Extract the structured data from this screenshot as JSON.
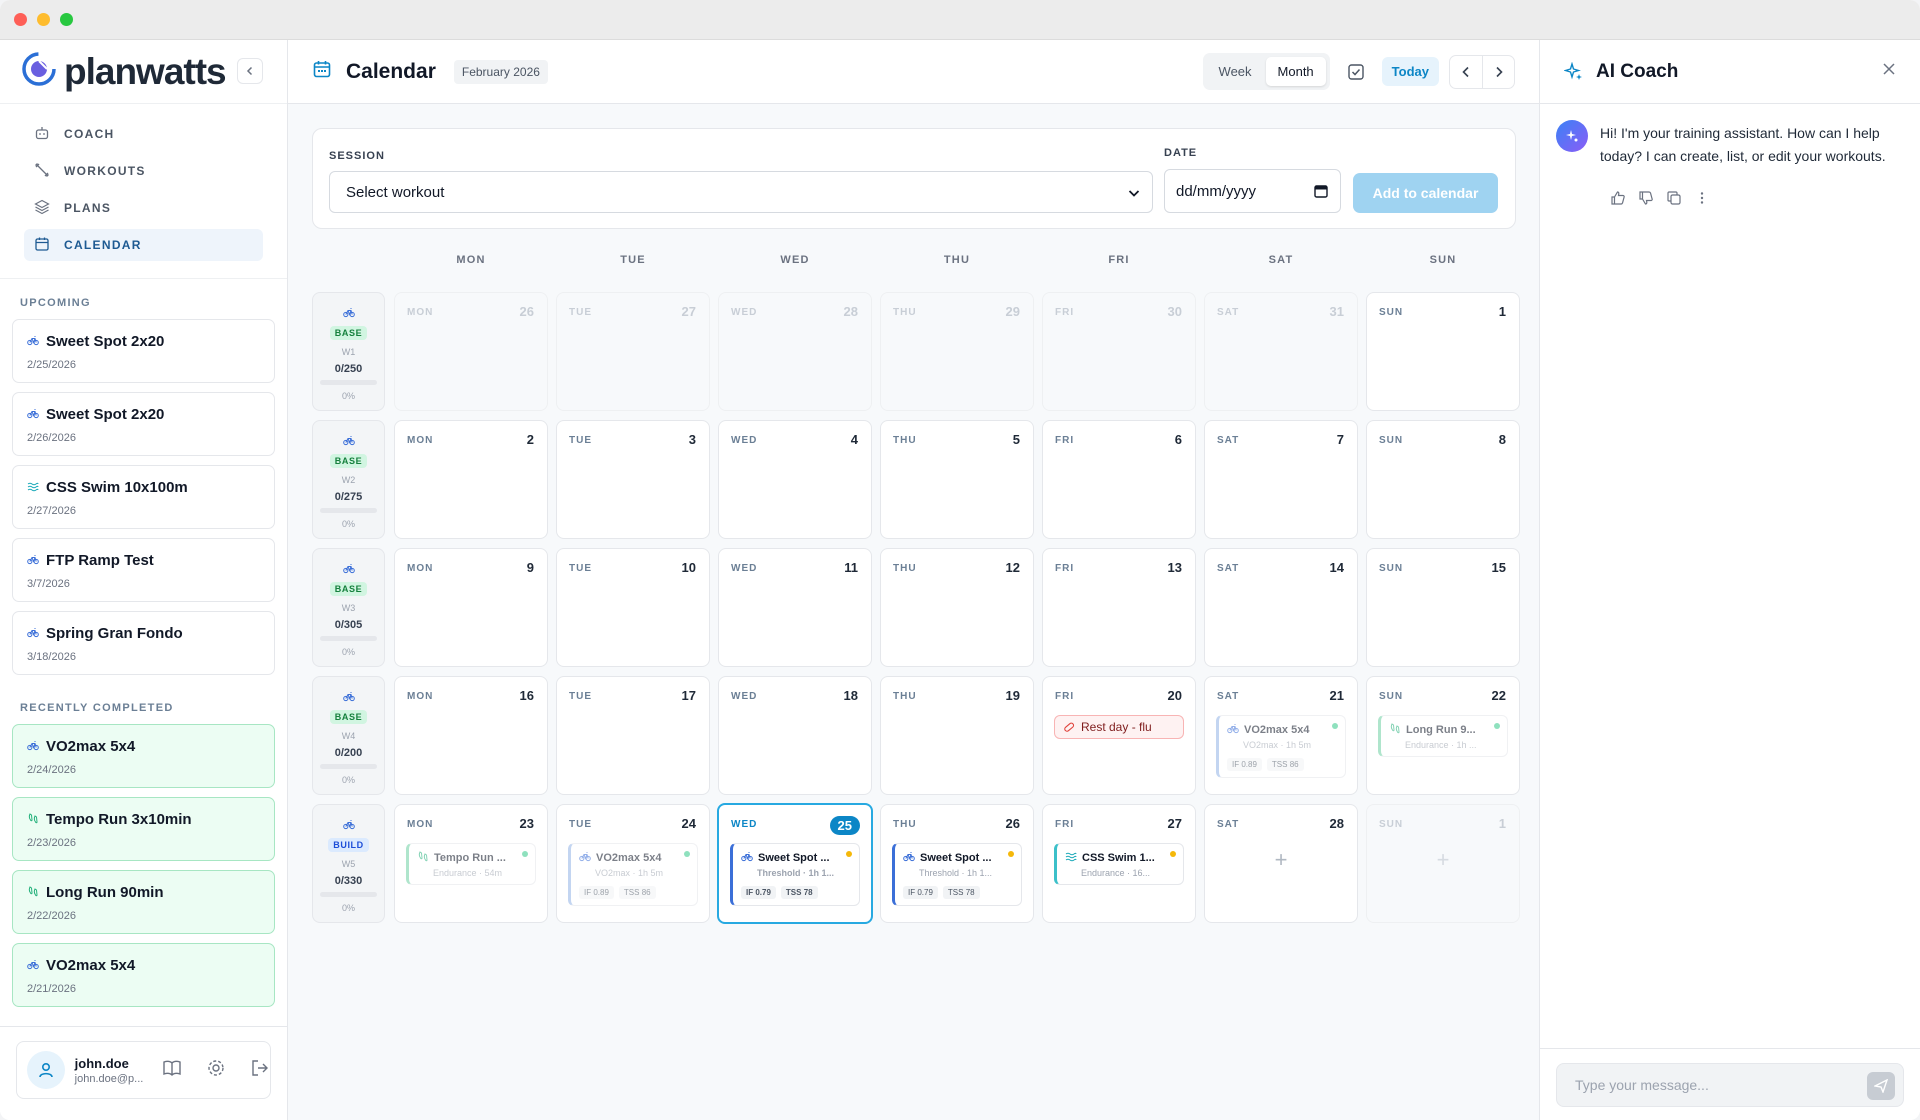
{
  "brand": {
    "name": "planwatts"
  },
  "nav": [
    {
      "label": "COACH",
      "icon": "robot-icon",
      "active": false
    },
    {
      "label": "WORKOUTS",
      "icon": "dumbbell-icon",
      "active": false
    },
    {
      "label": "PLANS",
      "icon": "layers-icon",
      "active": false
    },
    {
      "label": "CALENDAR",
      "icon": "calendar-icon",
      "active": true
    }
  ],
  "upcoming": {
    "label": "UPCOMING",
    "items": [
      {
        "title": "Sweet Spot 2x20",
        "date": "2/25/2026",
        "sport": "bike"
      },
      {
        "title": "Sweet Spot 2x20",
        "date": "2/26/2026",
        "sport": "bike"
      },
      {
        "title": "CSS Swim 10x100m",
        "date": "2/27/2026",
        "sport": "swim"
      },
      {
        "title": "FTP Ramp Test",
        "date": "3/7/2026",
        "sport": "bike"
      },
      {
        "title": "Spring Gran Fondo",
        "date": "3/18/2026",
        "sport": "bike"
      }
    ]
  },
  "completed": {
    "label": "RECENTLY COMPLETED",
    "items": [
      {
        "title": "VO2max 5x4",
        "date": "2/24/2026",
        "sport": "bike"
      },
      {
        "title": "Tempo Run 3x10min",
        "date": "2/23/2026",
        "sport": "run"
      },
      {
        "title": "Long Run 90min",
        "date": "2/22/2026",
        "sport": "run"
      },
      {
        "title": "VO2max 5x4",
        "date": "2/21/2026",
        "sport": "bike"
      }
    ]
  },
  "user": {
    "name": "john.doe",
    "email": "john.doe@p..."
  },
  "header": {
    "title": "Calendar",
    "month": "February 2026",
    "view_week": "Week",
    "view_month": "Month",
    "active_view": "Month",
    "today_label": "Today"
  },
  "form": {
    "session_label": "SESSION",
    "session_value": "Select workout",
    "date_label": "DATE",
    "date_placeholder": "dd/mm/yyyy",
    "add_label": "Add to calendar"
  },
  "weekdays": [
    "MON",
    "TUE",
    "WED",
    "THU",
    "FRI",
    "SAT",
    "SUN"
  ],
  "weeks": [
    {
      "phase": "BASE",
      "week": "W1",
      "load": "0/250",
      "pct": "0%",
      "days": [
        {
          "name": "MON",
          "num": "26",
          "out": true
        },
        {
          "name": "TUE",
          "num": "27",
          "out": true
        },
        {
          "name": "WED",
          "num": "28",
          "out": true
        },
        {
          "name": "THU",
          "num": "29",
          "out": true
        },
        {
          "name": "FRI",
          "num": "30",
          "out": true
        },
        {
          "name": "SAT",
          "num": "31",
          "out": true
        },
        {
          "name": "SUN",
          "num": "1"
        }
      ]
    },
    {
      "phase": "BASE",
      "week": "W2",
      "load": "0/275",
      "pct": "0%",
      "days": [
        {
          "name": "MON",
          "num": "2"
        },
        {
          "name": "TUE",
          "num": "3"
        },
        {
          "name": "WED",
          "num": "4"
        },
        {
          "name": "THU",
          "num": "5"
        },
        {
          "name": "FRI",
          "num": "6"
        },
        {
          "name": "SAT",
          "num": "7"
        },
        {
          "name": "SUN",
          "num": "8"
        }
      ]
    },
    {
      "phase": "BASE",
      "week": "W3",
      "load": "0/305",
      "pct": "0%",
      "days": [
        {
          "name": "MON",
          "num": "9"
        },
        {
          "name": "TUE",
          "num": "10"
        },
        {
          "name": "WED",
          "num": "11"
        },
        {
          "name": "THU",
          "num": "12"
        },
        {
          "name": "FRI",
          "num": "13"
        },
        {
          "name": "SAT",
          "num": "14"
        },
        {
          "name": "SUN",
          "num": "15"
        }
      ]
    },
    {
      "phase": "BASE",
      "week": "W4",
      "load": "0/200",
      "pct": "0%",
      "days": [
        {
          "name": "MON",
          "num": "16"
        },
        {
          "name": "TUE",
          "num": "17"
        },
        {
          "name": "WED",
          "num": "18"
        },
        {
          "name": "THU",
          "num": "19"
        },
        {
          "name": "FRI",
          "num": "20",
          "rest": "Rest day - flu"
        },
        {
          "name": "SAT",
          "num": "21",
          "event": {
            "title": "VO2max 5x4",
            "sub": "VO2max · 1h 5m",
            "sport": "bike",
            "dot": "#34c98a",
            "if": "IF 0.89",
            "tss": "TSS 86",
            "faded": true
          }
        },
        {
          "name": "SUN",
          "num": "22",
          "event": {
            "title": "Long Run 9...",
            "sub": "Endurance · 1h ...",
            "sport": "run",
            "dot": "#34c98a",
            "faded": true
          }
        }
      ]
    },
    {
      "phase": "BUILD",
      "week": "W5",
      "load": "0/330",
      "pct": "0%",
      "days": [
        {
          "name": "MON",
          "num": "23",
          "event": {
            "title": "Tempo Run ...",
            "sub": "Endurance · 54m",
            "sport": "run",
            "dot": "#34c98a",
            "faded": true
          }
        },
        {
          "name": "TUE",
          "num": "24",
          "event": {
            "title": "VO2max 5x4",
            "sub": "VO2max · 1h 5m",
            "sport": "bike",
            "dot": "#34c98a",
            "if": "IF 0.89",
            "tss": "TSS 86",
            "faded": true
          }
        },
        {
          "name": "WED",
          "num": "25",
          "today": true,
          "event": {
            "title": "Sweet Spot ...",
            "sub": "Threshold · 1h 1...",
            "sport": "bike",
            "dot": "#f5b80a",
            "if": "IF 0.79",
            "tss": "TSS 78"
          }
        },
        {
          "name": "THU",
          "num": "26",
          "event": {
            "title": "Sweet Spot ...",
            "sub": "Threshold · 1h 1...",
            "sport": "bike",
            "dot": "#f5b80a",
            "if": "IF 0.79",
            "tss": "TSS 78"
          }
        },
        {
          "name": "FRI",
          "num": "27",
          "event": {
            "title": "CSS Swim 1...",
            "sub": "Endurance · 16...",
            "sport": "swim",
            "dot": "#f5b80a"
          }
        },
        {
          "name": "SAT",
          "num": "28",
          "plus": "+"
        },
        {
          "name": "SUN",
          "num": "1",
          "out": true,
          "plus": "+"
        }
      ]
    }
  ],
  "coach": {
    "title": "AI Coach",
    "message": "Hi! I'm your training assistant. How can I help today? I can create, list, or edit your workouts.",
    "input_placeholder": "Type your message..."
  }
}
